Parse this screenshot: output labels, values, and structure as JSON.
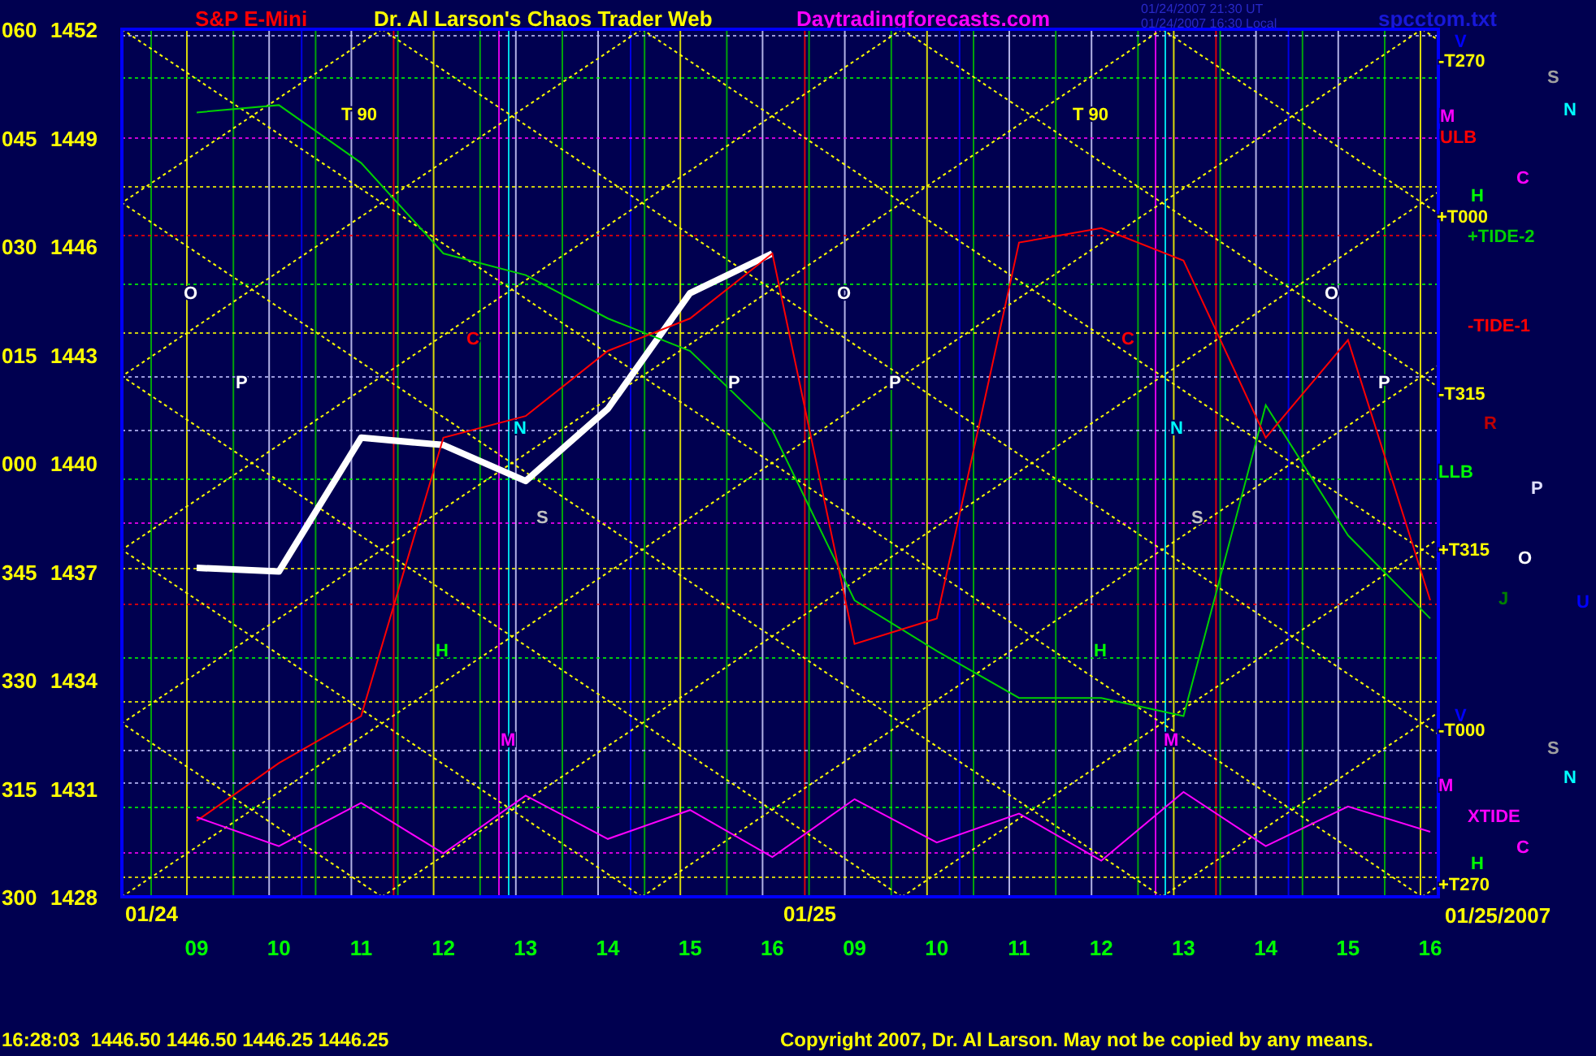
{
  "header": {
    "title": "Dr. Al Larson's Chaos Trader Web",
    "site": "Daytradingforecasts.com",
    "timestamps": [
      "01/24/2007 21:30 UT",
      "01/24/2007 16:30 Local"
    ],
    "file": "spcctom.txt"
  },
  "chart": {
    "chart_data": {
      "type": "line",
      "categories": [
        "09",
        "10",
        "11",
        "12",
        "13",
        "14",
        "15",
        "16",
        "09",
        "10",
        "11",
        "12",
        "13",
        "14",
        "15",
        "16"
      ],
      "series": [
        {
          "name": "S&P E-Mini",
          "color": "#ffffff",
          "values": [
            1437.1,
            1437,
            1440.7,
            1440.5,
            1439.5,
            1441.5,
            1444.7,
            1445.8,
            null,
            null,
            null,
            null,
            null,
            null,
            null,
            null
          ]
        },
        {
          "name": "+TIDE-2",
          "color": "#00d000",
          "values": [
            1449.7,
            1449.9,
            1448.3,
            1445.8,
            1445.2,
            1444,
            1443.1,
            1440.9,
            1436.2,
            1434.8,
            1433.5,
            1433.5,
            1433,
            1441.6,
            1438,
            1435.7
          ]
        },
        {
          "name": "-TIDE-1",
          "color": "#ff0000",
          "values": [
            1430.1,
            1431.7,
            1433,
            1440.7,
            1441.3,
            1443.1,
            1444,
            1445.8,
            1435,
            1435.7,
            1446.1,
            1446.5,
            1445.6,
            1440.7,
            1443.4,
            1436.2
          ]
        },
        {
          "name": "XTIDE",
          "color": "#ff00ff",
          "values": [
            1430.2,
            1429.4,
            1430.6,
            1429.2,
            1430.8,
            1429.6,
            1430.4,
            1429.1,
            1430.7,
            1429.5,
            1430.3,
            1429.0,
            1430.9,
            1429.4,
            1430.5,
            1429.8
          ]
        }
      ],
      "ylim": [
        1428,
        1452
      ],
      "yticks": [
        1452,
        1449,
        1446,
        1443,
        1440,
        1437,
        1434,
        1431,
        1428
      ]
    },
    "degree_labels": [
      "060",
      "045",
      "030",
      "015",
      "000",
      "345",
      "330",
      "315",
      "300"
    ],
    "day_labels": [
      "01/24",
      "01/25"
    ],
    "end_date": "01/25/2007",
    "plot_labels": [
      {
        "text": "T 90",
        "color": "#ffff00"
      },
      {
        "text": "T 90",
        "color": "#ffff00"
      },
      {
        "text": "O",
        "color": "#ffffff"
      },
      {
        "text": "O",
        "color": "#ffffff"
      },
      {
        "text": "O",
        "color": "#ffffff"
      },
      {
        "text": "P",
        "color": "#ffffff"
      },
      {
        "text": "P",
        "color": "#ffffff"
      },
      {
        "text": "P",
        "color": "#ffffff"
      },
      {
        "text": "P",
        "color": "#ffffff"
      },
      {
        "text": "C",
        "color": "#ff0000"
      },
      {
        "text": "C",
        "color": "#ff0000"
      },
      {
        "text": "N",
        "color": "#00ffff"
      },
      {
        "text": "N",
        "color": "#00ffff"
      },
      {
        "text": "S",
        "color": "#c0c0c0"
      },
      {
        "text": "S",
        "color": "#c0c0c0"
      },
      {
        "text": "H",
        "color": "#00ff00"
      },
      {
        "text": "H",
        "color": "#00ff00"
      },
      {
        "text": "M",
        "color": "#ff00ff"
      },
      {
        "text": "M",
        "color": "#ff00ff"
      }
    ],
    "right_labels": [
      {
        "text": "V",
        "color": "#0000ff"
      },
      {
        "text": "-T270",
        "color": "#ffff00"
      },
      {
        "text": "S",
        "color": "#a0a0a0"
      },
      {
        "text": "N",
        "color": "#00ffff"
      },
      {
        "text": "M",
        "color": "#ff00ff"
      },
      {
        "text": "ULB",
        "color": "#ff0000"
      },
      {
        "text": "C",
        "color": "#ff00ff"
      },
      {
        "text": "H",
        "color": "#00ff00"
      },
      {
        "text": "+T000",
        "color": "#ffff00"
      },
      {
        "text": "-T315",
        "color": "#ffff00"
      },
      {
        "text": "R",
        "color": "#c00000"
      },
      {
        "text": "LLB",
        "color": "#00ff00"
      },
      {
        "text": "P",
        "color": "#e0e0ff"
      },
      {
        "text": "+T315",
        "color": "#ffff00"
      },
      {
        "text": "O",
        "color": "#ffffff"
      },
      {
        "text": "J",
        "color": "#008000"
      },
      {
        "text": "U",
        "color": "#0000ff"
      },
      {
        "text": "V",
        "color": "#0000ff"
      },
      {
        "text": "-T000",
        "color": "#ffff00"
      },
      {
        "text": "S",
        "color": "#a0a0a0"
      },
      {
        "text": "N",
        "color": "#00ffff"
      },
      {
        "text": "M",
        "color": "#ff00ff"
      },
      {
        "text": "C",
        "color": "#ff00ff"
      },
      {
        "text": "H",
        "color": "#00ff00"
      },
      {
        "text": "+T270",
        "color": "#ffff00"
      }
    ]
  },
  "footer": {
    "quote": "16:28:03  1446.50 1446.50 1446.25 1446.25",
    "copyright": "Copyright 2007, Dr. Al Larson. May not be copied by any means."
  }
}
